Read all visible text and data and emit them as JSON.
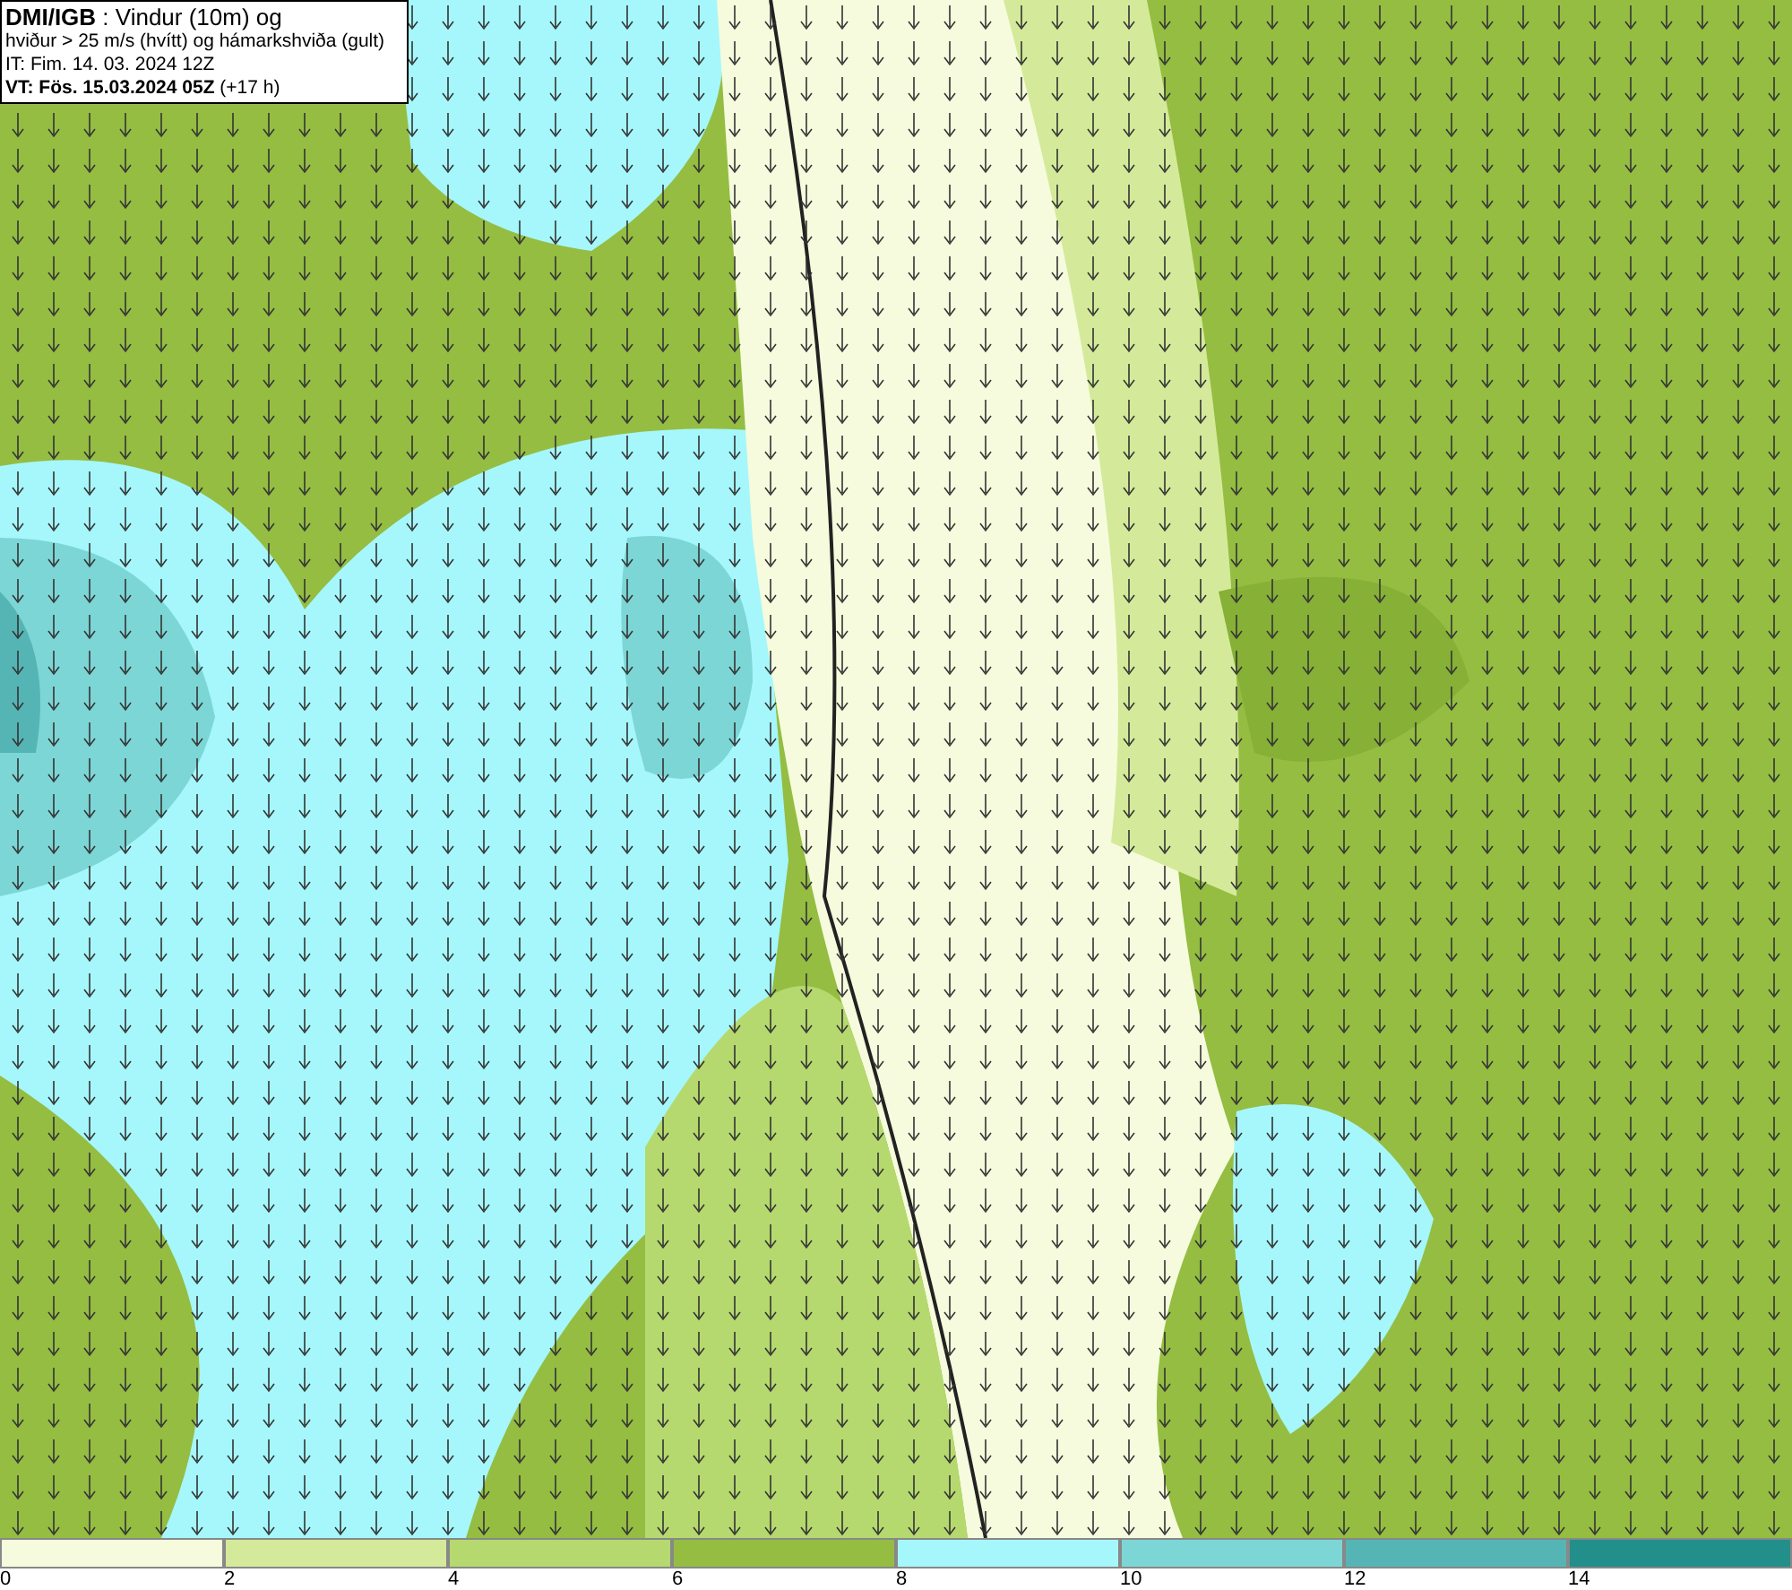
{
  "info_box": {
    "lines": [
      "**DMI/IGB** : Vindur (10m) og",
      "hviður > 25 m/s (hvítt) og hámarkshviða (gult)",
      "IT: Fim. 14. 03. 2024 12Z",
      "**VT: Fös. 15.03.2024 05Z** (+17 h)"
    ]
  },
  "legend": [
    {
      "label": "0",
      "color": "#f5fbdc"
    },
    {
      "label": "2",
      "color": "#d4ea9a"
    },
    {
      "label": "4",
      "color": "#b5d96e"
    },
    {
      "label": "6",
      "color": "#94bd42"
    },
    {
      "label": "8",
      "color": "#a6f7fb"
    },
    {
      "label": "10",
      "color": "#7dd6d6"
    },
    {
      "label": "12",
      "color": "#55b5b5"
    },
    {
      "label": "14",
      "color": "#228f8b"
    }
  ]
}
